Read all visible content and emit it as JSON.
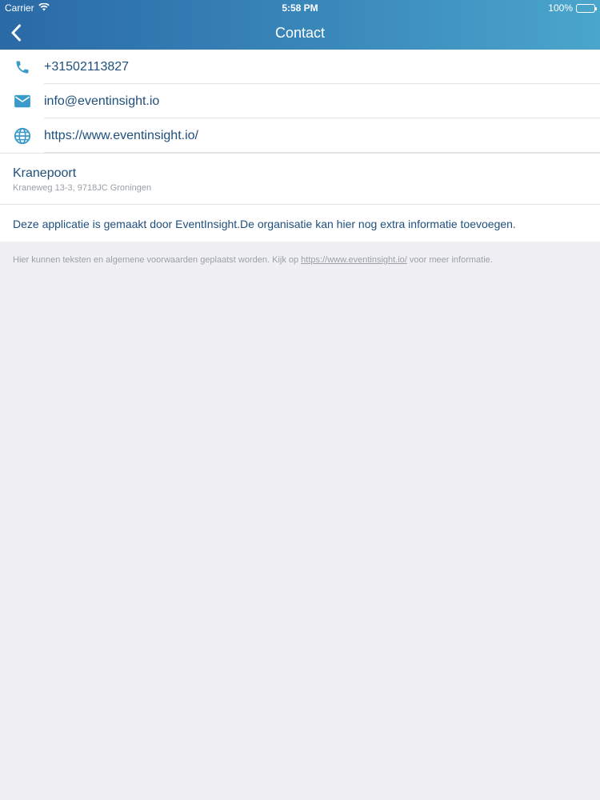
{
  "status_bar": {
    "carrier": "Carrier",
    "time": "5:58 PM",
    "battery": "100%"
  },
  "nav": {
    "title": "Contact"
  },
  "contact": {
    "phone": "+31502113827",
    "email": "info@eventinsight.io",
    "website": "https://www.eventinsight.io/"
  },
  "address": {
    "name": "Kranepoort",
    "street": "Kraneweg 13-3, 9718JC Groningen"
  },
  "info_text": "Deze applicatie is gemaakt door EventInsight.De organisatie kan hier nog extra informatie toevoegen.",
  "footer": {
    "prefix": "Hier kunnen teksten en algemene voorwaarden geplaatst worden. Kijk op ",
    "link": "https://www.eventinsight.io/",
    "suffix": " voor meer informatie."
  },
  "colors": {
    "accent": "#3a9ac9",
    "text": "#1f4f7c"
  }
}
